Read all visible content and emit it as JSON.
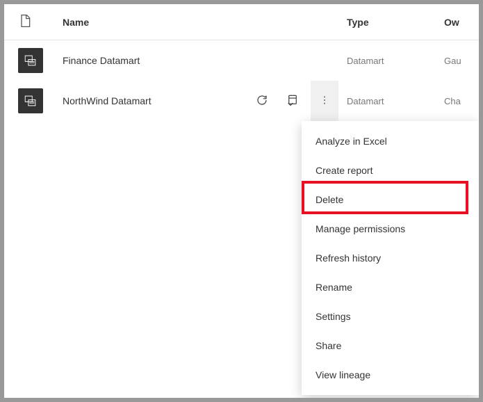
{
  "header": {
    "name": "Name",
    "type": "Type",
    "owner": "Ow"
  },
  "rows": [
    {
      "name": "Finance Datamart",
      "type": "Datamart",
      "owner": "Gau"
    },
    {
      "name": "NorthWind Datamart",
      "type": "Datamart",
      "owner": "Cha"
    }
  ],
  "menu": {
    "analyze": "Analyze in Excel",
    "create": "Create report",
    "delete": "Delete",
    "permissions": "Manage permissions",
    "refresh": "Refresh history",
    "rename": "Rename",
    "settings": "Settings",
    "share": "Share",
    "lineage": "View lineage"
  }
}
